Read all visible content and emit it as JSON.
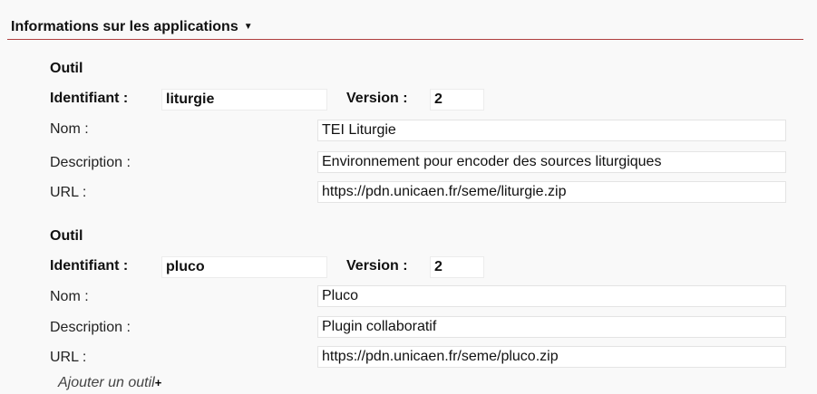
{
  "section": {
    "title": "Informations sur les applications"
  },
  "labels": {
    "tool_heading": "Outil",
    "identifier": "Identifiant :",
    "version": "Version :",
    "name": "Nom :",
    "description": "Description :",
    "url": "URL :"
  },
  "tools": [
    {
      "identifier": "liturgie",
      "version": "2",
      "name": "TEI Liturgie",
      "description": "Environnement pour encoder des sources liturgiques",
      "url": "https://pdn.unicaen.fr/seme/liturgie.zip"
    },
    {
      "identifier": "pluco",
      "version": "2",
      "name": "Pluco",
      "description": "Plugin collaboratif",
      "url": "https://pdn.unicaen.fr/seme/pluco.zip"
    }
  ],
  "add_tool_label": "Ajouter un outil",
  "icons": {
    "section_toggle": "caret-down-icon",
    "add": "plus-icon"
  }
}
